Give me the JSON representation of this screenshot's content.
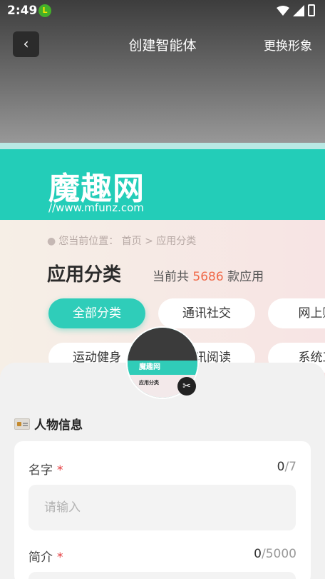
{
  "status_bar": {
    "time": "2:49",
    "notif_letter": "L"
  },
  "header": {
    "back_icon": "chevron-left-icon",
    "title": "创建智能体",
    "action": "更换形象"
  },
  "preview": {
    "logo": "魔趣网",
    "url": "//www.mfunz.com",
    "breadcrumb": "您当前位置：  首页 > 应用分类",
    "section_title": "应用分类",
    "count_prefix": "当前共",
    "count_num": "5686",
    "count_suffix": "款应用",
    "tabs": [
      "全部分类",
      "通讯社交",
      "网上购",
      "运动健身",
      "资讯阅读",
      "系统工"
    ]
  },
  "avatar": {
    "banner": "魔趣网",
    "body": "应用分类"
  },
  "section": {
    "label": "人物信息"
  },
  "form": {
    "name_label": "名字",
    "name_cur": "0",
    "name_max": "/7",
    "name_placeholder": "请输入",
    "intro_label": "简介",
    "intro_cur": "0",
    "intro_max": "/5000",
    "required_mark": "*"
  },
  "colors": {
    "accent": "#2fcdb9",
    "required": "#e4393c",
    "count_highlight": "#f06a4a"
  }
}
